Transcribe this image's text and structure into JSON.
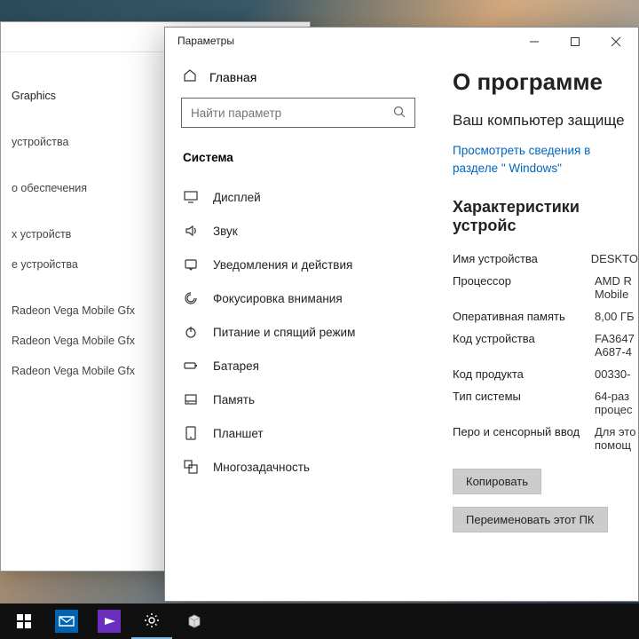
{
  "back_window": {
    "graphics": "Graphics",
    "devices": " устройства",
    "software": "о обеспечения",
    "other_devices": "х устройств",
    "device": "е устройства",
    "gpu_rows": [
      "Radeon Vega Mobile Gfx",
      "Radeon Vega Mobile Gfx",
      "Radeon Vega Mobile Gfx"
    ]
  },
  "settings": {
    "app_title": "Параметры",
    "home": "Главная",
    "search_placeholder": "Найти параметр",
    "category": "Система",
    "nav": [
      {
        "icon": "display",
        "label": "Дисплей"
      },
      {
        "icon": "sound",
        "label": "Звук"
      },
      {
        "icon": "notify",
        "label": "Уведомления и действия"
      },
      {
        "icon": "focus",
        "label": "Фокусировка внимания"
      },
      {
        "icon": "power",
        "label": "Питание и спящий режим"
      },
      {
        "icon": "battery",
        "label": "Батарея"
      },
      {
        "icon": "storage",
        "label": "Память"
      },
      {
        "icon": "tablet",
        "label": "Планшет"
      },
      {
        "icon": "multi",
        "label": "Многозадачность"
      }
    ],
    "page": {
      "title": "О программе",
      "subtitle": "Ваш компьютер защище",
      "link": "Просмотреть сведения в разделе \"\nWindows\"",
      "section": "Характеристики устройс",
      "specs": [
        {
          "k": "Имя устройства",
          "v": "DESKTO"
        },
        {
          "k": "Процессор",
          "v": "AMD R\nMobile"
        },
        {
          "k": "Оперативная память",
          "v": "8,00 ГБ"
        },
        {
          "k": "Код устройства",
          "v": "FA3647\nA687-4"
        },
        {
          "k": "Код продукта",
          "v": "00330-"
        },
        {
          "k": "Тип системы",
          "v": "64-раз\nпроцес"
        },
        {
          "k": "Перо и сенсорный ввод",
          "v": "Для это\nпомощ"
        }
      ],
      "copy": "Копировать",
      "rename": "Переименовать этот ПК"
    }
  }
}
